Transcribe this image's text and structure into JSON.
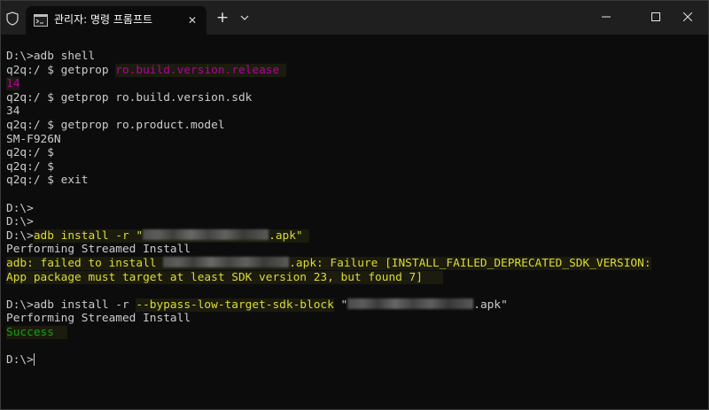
{
  "titlebar": {
    "tab_title": "관리자: 명령 프롬프트",
    "close_glyph": "✕",
    "new_tab_glyph": "+"
  },
  "colors": {
    "background": "#0c0c0c",
    "text": "#cccccc",
    "yellow": "#dcdc36",
    "magenta": "#b4009e",
    "green": "#13a10e"
  },
  "terminal": {
    "l1": "D:\\>adb shell",
    "l2_prompt": "q2q:/ $ getprop ",
    "l2_arg": "ro.build.version.release",
    "l3": "14",
    "l4": "q2q:/ $ getprop ro.build.version.sdk",
    "l5": "34",
    "l6": "q2q:/ $ getprop ro.product.model",
    "l7": "SM-F926N",
    "l8": "q2q:/ $",
    "l9": "q2q:/ $",
    "l10": "q2q:/ $ exit",
    "l11": "",
    "l12": "D:\\>",
    "l13": "D:\\>",
    "l14_prompt": "D:\\>",
    "l14_cmd": "adb install -r \"",
    "l14_ext": ".apk\"",
    "l15": "Performing Streamed Install",
    "l16_start": "adb: failed to install ",
    "l16_end": ".apk: Failure [INSTALL_FAILED_DEPRECATED_SDK_VERSION:",
    "l17": "App package must target at least SDK version 23, but found 7]",
    "l18": "",
    "l19_prompt": "D:\\>adb install -r ",
    "l19_flag": "--bypass-low-target-sdk-block",
    "l19_quote": " \"",
    "l19_ext": ".apk\"",
    "l20": "Performing Streamed Install",
    "l21": "Success",
    "l22": "",
    "l23": "D:\\>"
  }
}
